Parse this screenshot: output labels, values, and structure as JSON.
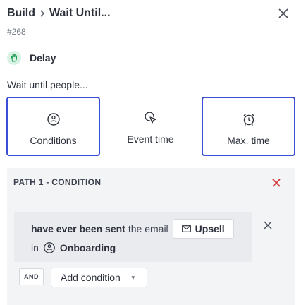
{
  "header": {
    "breadcrumb_root": "Build",
    "breadcrumb_current": "Wait Until...",
    "id_label": "#268"
  },
  "step": {
    "type_label": "Delay",
    "description": "Wait until people..."
  },
  "options": [
    {
      "label": "Conditions",
      "icon": "condition-icon",
      "selected": true
    },
    {
      "label": "Event time",
      "icon": "cursor-click-icon",
      "selected": false
    },
    {
      "label": "Max. time",
      "icon": "alarm-clock-icon",
      "selected": true
    }
  ],
  "path": {
    "header": "PATH 1 - CONDITION",
    "condition": {
      "action": "have ever been sent",
      "connector": "the email",
      "email_name": "Upsell",
      "in_word": "in",
      "campaign": "Onboarding"
    },
    "and_label": "AND",
    "add_condition_label": "Add condition"
  },
  "colors": {
    "accent_border": "#3b4fd6",
    "remove_red": "#d6363b",
    "delay_badge_bg": "#d8f3e3",
    "delay_icon": "#1f9d55"
  }
}
